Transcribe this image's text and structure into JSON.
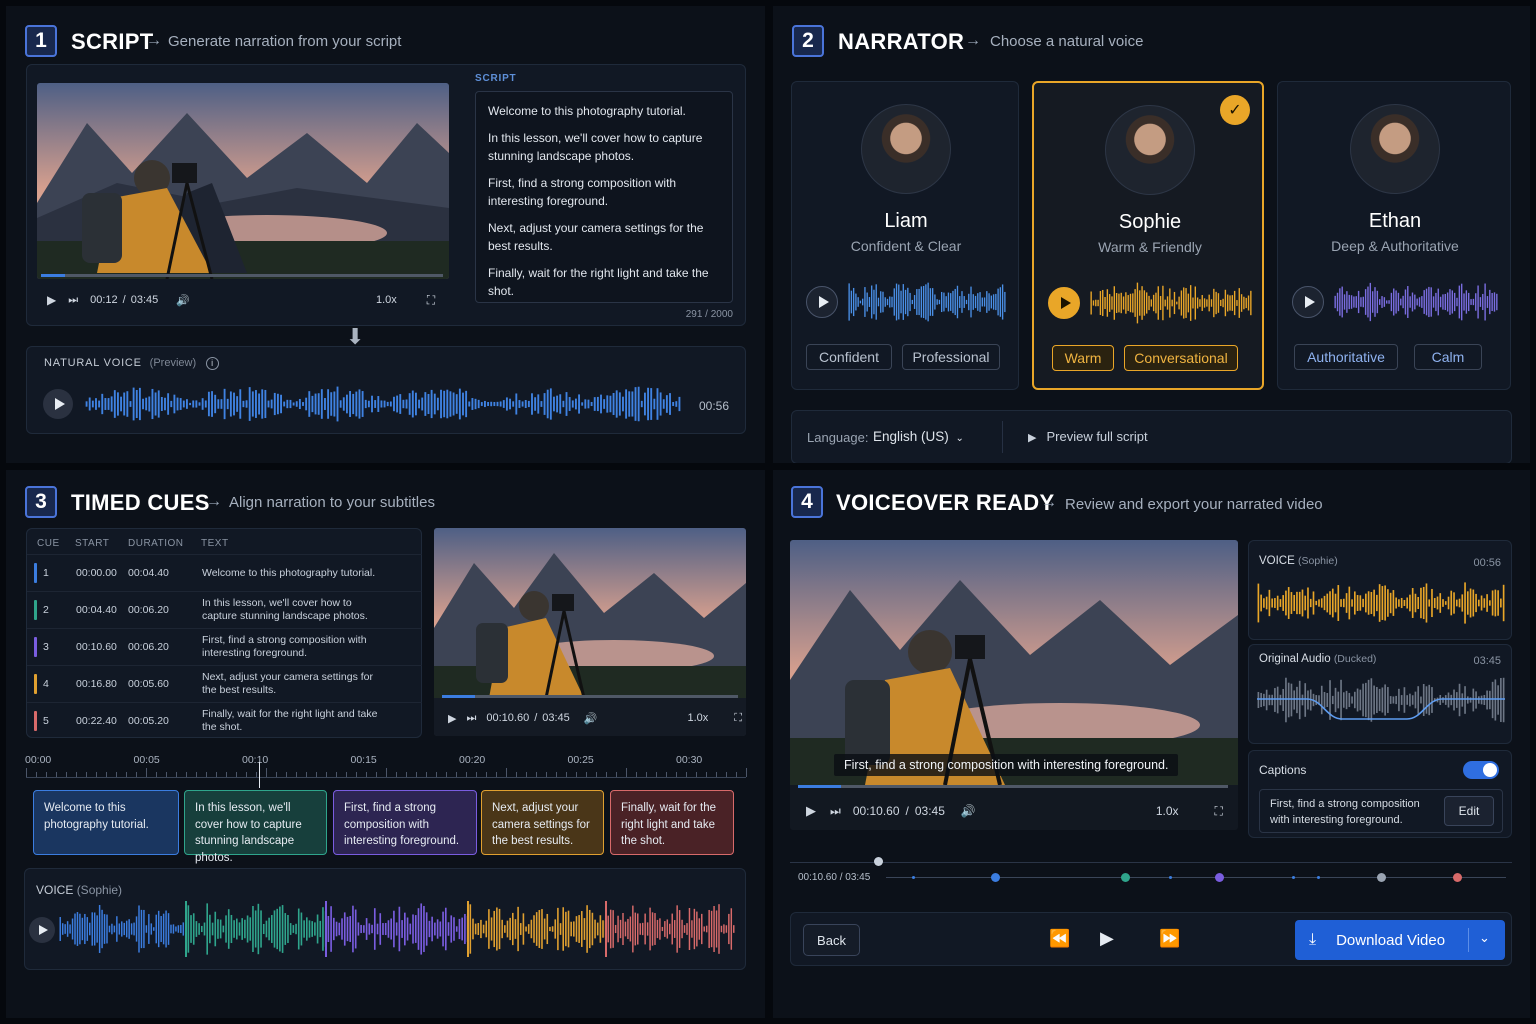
{
  "q1": {
    "step": "1",
    "title": "SCRIPT",
    "subtitle": "Generate narration from your script",
    "player": {
      "time": "00:12",
      "duration": "03:45",
      "speed": "1.0x",
      "progress": 0.12
    },
    "script_label": "SCRIPT",
    "script_lines": [
      "Welcome to this photography tutorial.",
      "In this lesson, we'll cover how to capture stunning landscape photos.",
      "First, find a strong composition with interesting foreground.",
      "Next, adjust your camera settings for the best results.",
      "Finally, wait for the right light and take the shot."
    ],
    "char_count": "291",
    "char_limit": "2000",
    "voice_label": "NATURAL VOICE",
    "voice_preview": "(Preview)",
    "voice_duration": "00:56"
  },
  "q2": {
    "step": "2",
    "title": "NARRATOR",
    "subtitle": "Choose a natural voice",
    "narrators": [
      {
        "name": "Liam",
        "desc": "Confident & Clear",
        "tags": [
          "Confident",
          "Professional"
        ],
        "color": "#4a8fe6",
        "selected": false
      },
      {
        "name": "Sophie",
        "desc": "Warm & Friendly",
        "tags": [
          "Warm",
          "Conversational"
        ],
        "color": "#e9a628",
        "selected": true
      },
      {
        "name": "Ethan",
        "desc": "Deep & Authoritative",
        "tags": [
          "Authoritative",
          "Calm"
        ],
        "color": "#7a6de0",
        "selected": false
      }
    ],
    "language_label": "Language:",
    "language_value": "English (US)",
    "preview_label": "Preview full script"
  },
  "q3": {
    "step": "3",
    "title": "TIMED CUES",
    "subtitle": "Align narration to your subtitles",
    "headers": [
      "CUE",
      "START",
      "DURATION",
      "TEXT"
    ],
    "cues": [
      {
        "n": "1",
        "start": "00:00.00",
        "dur": "00:04.40",
        "text": "Welcome to this photography tutorial.",
        "color": "#3b7de0"
      },
      {
        "n": "2",
        "start": "00:04.40",
        "dur": "00:06.20",
        "text": "In this lesson, we'll cover how to capture stunning landscape photos.",
        "color": "#2fa58c"
      },
      {
        "n": "3",
        "start": "00:10.60",
        "dur": "00:06.20",
        "text": "First, find a strong composition with interesting foreground.",
        "color": "#7a5de0"
      },
      {
        "n": "4",
        "start": "00:16.80",
        "dur": "00:05.60",
        "text": "Next, adjust your camera settings for the best results.",
        "color": "#e0a030"
      },
      {
        "n": "5",
        "start": "00:22.40",
        "dur": "00:05.20",
        "text": "Finally, wait for the right light and take the shot.",
        "color": "#d86a6a"
      }
    ],
    "player": {
      "time": "00:10.60",
      "duration": "03:45",
      "speed": "1.0x",
      "progress": 0.05
    },
    "ruler": [
      "00:00",
      "00:05",
      "00:10",
      "00:15",
      "00:20",
      "00:25",
      "00:30"
    ],
    "boxes": [
      "Welcome to this photography tutorial.",
      "In this lesson, we'll cover how to capture stunning landscape photos.",
      "First, find a strong composition with interesting foreground.",
      "Next, adjust your camera settings for the best results.",
      "Finally, wait for the right light and take the shot."
    ],
    "voice_label": "VOICE",
    "voice_name": "(Sophie)"
  },
  "q4": {
    "step": "4",
    "title": "VOICEOVER READY",
    "subtitle": "Review and export your narrated video",
    "caption": "First, find a strong composition with interesting foreground.",
    "player": {
      "time": "00:10.60",
      "duration": "03:45",
      "speed": "1.0x",
      "progress": 0.1
    },
    "voice_label": "VOICE",
    "voice_name": "(Sophie)",
    "voice_duration": "00:56",
    "orig_label": "Original Audio",
    "orig_note": "(Ducked)",
    "orig_duration": "03:45",
    "captions_label": "Captions",
    "captions_on": true,
    "caption_text": "First, find a strong composition with interesting foreground.",
    "edit_label": "Edit",
    "timeline_time": "00:10.60",
    "timeline_duration": "03:45",
    "back_label": "Back",
    "download_label": "Download Video"
  }
}
